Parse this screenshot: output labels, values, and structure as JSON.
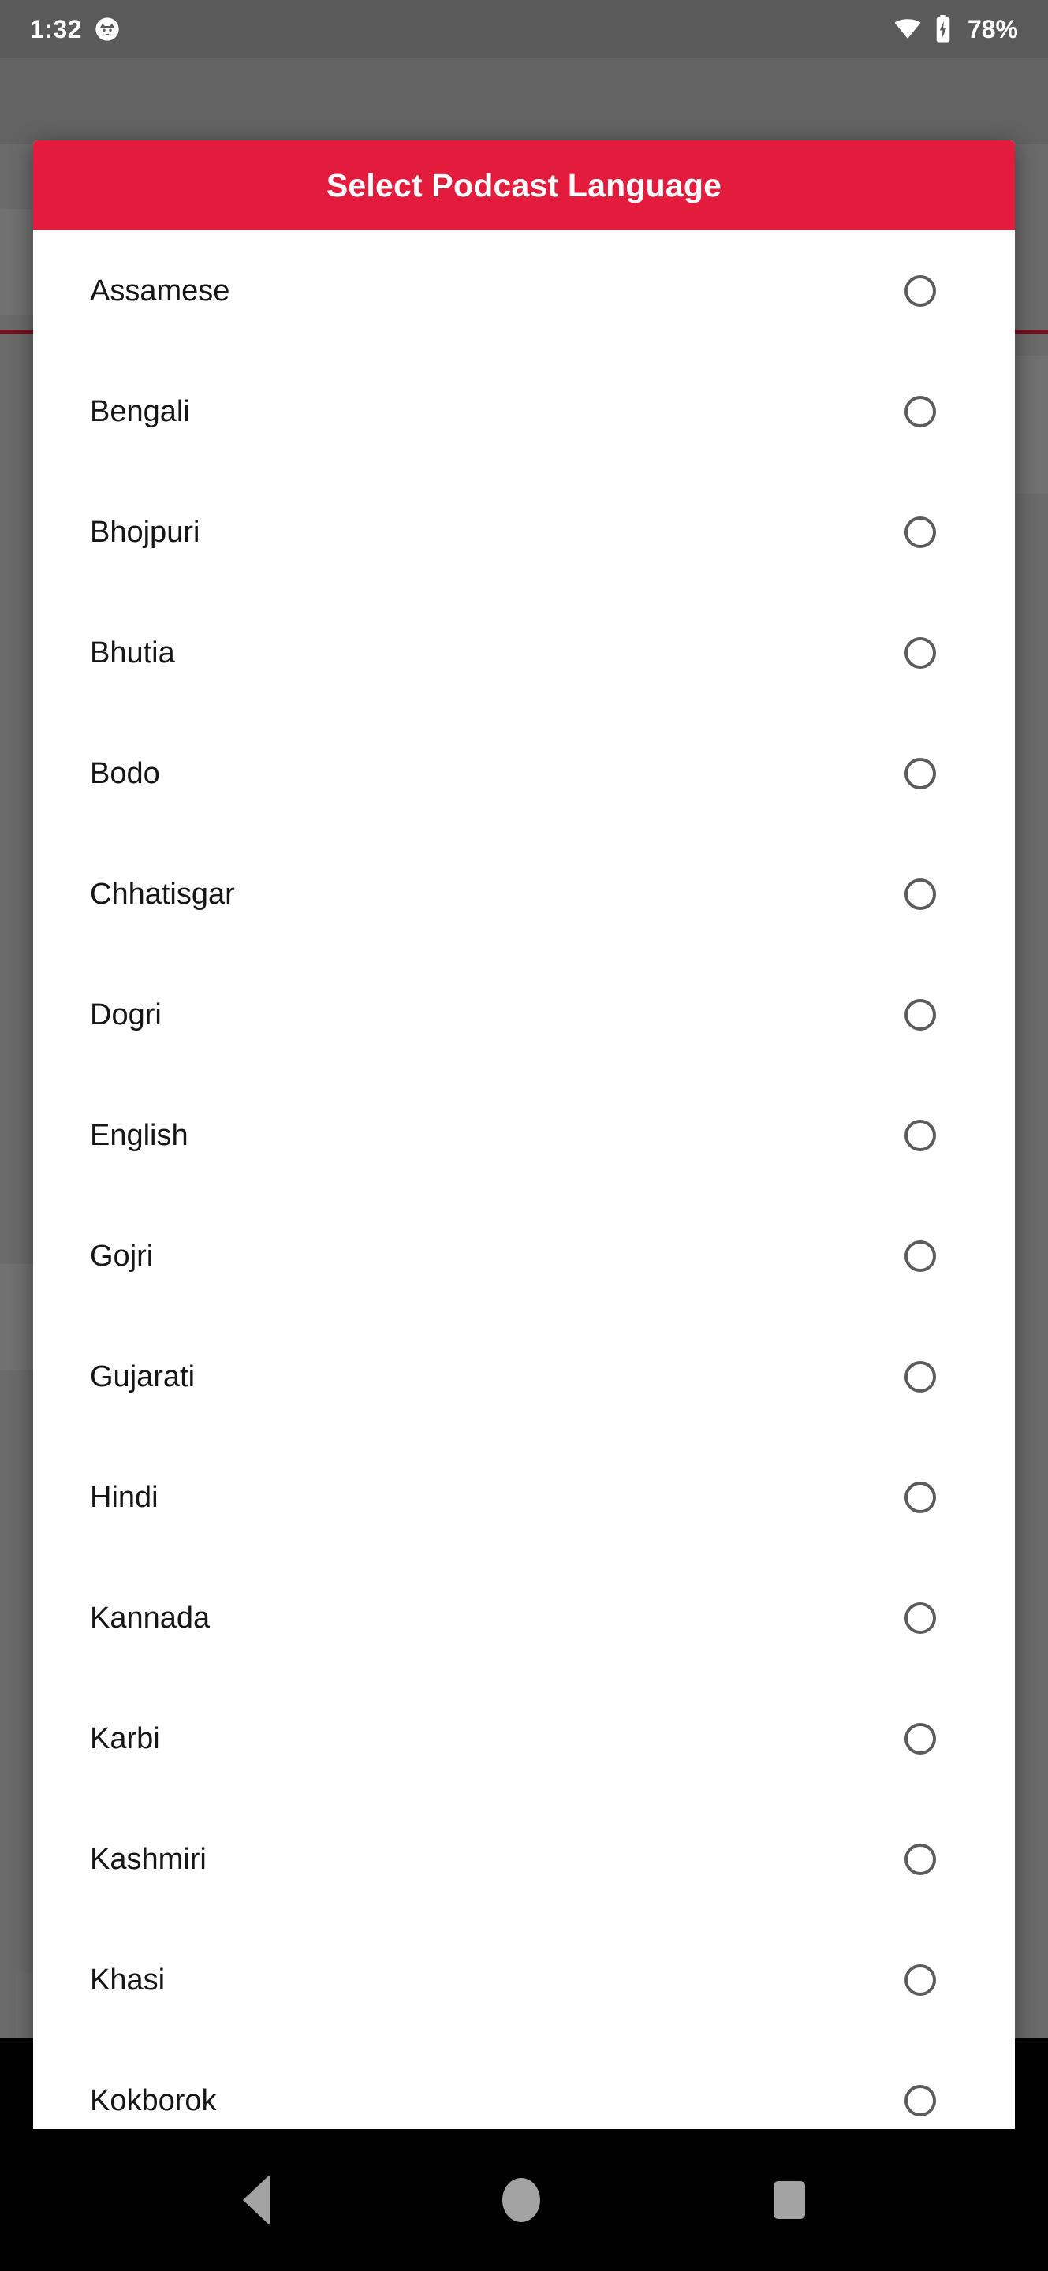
{
  "status_bar": {
    "time": "1:32",
    "notification_icon": "app-notification-icon",
    "wifi_icon": "wifi-icon",
    "battery_icon": "battery-charging-icon",
    "battery_percent": "78%"
  },
  "dialog": {
    "title": "Select Podcast Language",
    "header_color": "#E31C3D",
    "background_color": "#FFFFFF",
    "items": [
      {
        "label": "Assamese",
        "selected": false
      },
      {
        "label": "Bengali",
        "selected": false
      },
      {
        "label": "Bhojpuri",
        "selected": false
      },
      {
        "label": "Bhutia",
        "selected": false
      },
      {
        "label": "Bodo",
        "selected": false
      },
      {
        "label": "Chhatisgar",
        "selected": false
      },
      {
        "label": "Dogri",
        "selected": false
      },
      {
        "label": "English",
        "selected": false
      },
      {
        "label": "Gojri",
        "selected": false
      },
      {
        "label": "Gujarati",
        "selected": false
      },
      {
        "label": "Hindi",
        "selected": false
      },
      {
        "label": "Kannada",
        "selected": false
      },
      {
        "label": "Karbi",
        "selected": false
      },
      {
        "label": "Kashmiri",
        "selected": false
      },
      {
        "label": "Khasi",
        "selected": false
      },
      {
        "label": "Kokborok",
        "selected": false
      }
    ]
  },
  "navigation_bar": {
    "back_icon": "back-triangle-icon",
    "home_icon": "home-circle-icon",
    "recents_icon": "recents-square-icon"
  }
}
